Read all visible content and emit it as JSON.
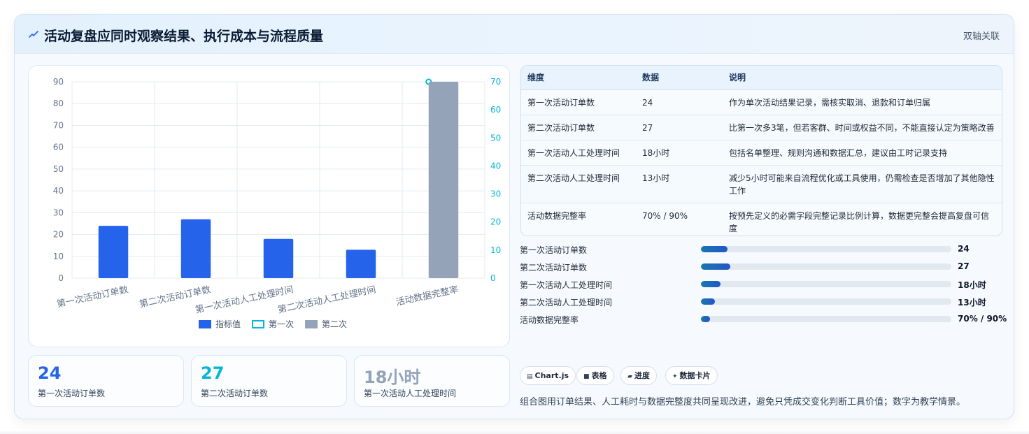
{
  "header": {
    "title": "活动复盘应同时观察结果、执行成本与流程质量",
    "tag": "双轴关联"
  },
  "colors": {
    "metric_bar": "#2563eb",
    "first_series": "#06b6d4",
    "second_series": "#94a3b8",
    "right_axis": "#06b6d4",
    "accent_text": "#2563eb"
  },
  "chart_data": {
    "type": "bar",
    "categories": [
      "第一次活动订单数",
      "第二次活动订单数",
      "第一次活动人工处理时间",
      "第二次活动人工处理时间",
      "活动数据完整率"
    ],
    "series": [
      {
        "name": "指标值",
        "type": "bar",
        "axis": "left",
        "values": [
          24,
          27,
          18,
          13,
          null
        ],
        "color": "#2563eb"
      },
      {
        "name": "第一次",
        "type": "line",
        "axis": "right",
        "values": [
          null,
          null,
          null,
          null,
          70
        ],
        "color": "#06b6d4"
      },
      {
        "name": "第二次",
        "type": "bar",
        "axis": "right",
        "values": [
          null,
          null,
          null,
          null,
          90
        ],
        "color": "#94a3b8"
      }
    ],
    "y_left": {
      "min": 0,
      "max": 90,
      "ticks": [
        "0",
        "10",
        "20",
        "30",
        "40",
        "50",
        "60",
        "70",
        "80",
        "90"
      ]
    },
    "y_right": {
      "min": 0,
      "max": 70,
      "ticks": [
        "0",
        "10",
        "20",
        "30",
        "40",
        "50",
        "60",
        "70"
      ]
    },
    "grid": true,
    "legend": "bottom"
  },
  "table": {
    "headers": [
      "维度",
      "数据",
      "说明"
    ],
    "rows": [
      [
        "第一次活动订单数",
        "24",
        "作为单次活动结果记录，需核实取消、退款和订单归属"
      ],
      [
        "第二次活动订单数",
        "27",
        "比第一次多3笔，但若客群、时间或权益不同，不能直接认定为策略改善"
      ],
      [
        "第一次活动人工处理时间",
        "18小时",
        "包括名单整理、规则沟通和数据汇总，建议由工时记录支持"
      ],
      [
        "第二次活动人工处理时间",
        "13小时",
        "减少5小时可能来自流程优化或工具使用，仍需检查是否增加了其他隐性工作"
      ],
      [
        "活动数据完整率",
        "70% / 90%",
        "按预先定义的必需字段完整记录比例计算，数据更完整会提高复盘可信度"
      ]
    ]
  },
  "progress": [
    {
      "label": "第一次活动订单数",
      "value": "24",
      "fraction": 0.105
    },
    {
      "label": "第二次活动订单数",
      "value": "27",
      "fraction": 0.118
    },
    {
      "label": "第一次活动人工处理时间",
      "value": "18小时",
      "fraction": 0.079
    },
    {
      "label": "第二次活动人工处理时间",
      "value": "13小时",
      "fraction": 0.057
    },
    {
      "label": "活动数据完整率",
      "value": "70% / 90%",
      "fraction": 0.035
    }
  ],
  "kpis": [
    {
      "value": "24",
      "label": "第一次活动订单数",
      "color": "#2563eb"
    },
    {
      "value": "27",
      "label": "第二次活动订单数",
      "color": "#06b6d4"
    },
    {
      "value": "18小时",
      "label": "第一次活动人工处理时间",
      "color": "#94a3b8"
    }
  ],
  "chips": [
    {
      "icon": "chart-icon",
      "glyph": "▤",
      "label": "Chart.js"
    },
    {
      "icon": "table-icon",
      "glyph": "■",
      "label": "表格"
    },
    {
      "icon": "progress-icon",
      "glyph": "▰",
      "label": "进度"
    },
    {
      "icon": "card-icon",
      "glyph": "✦",
      "label": "数据卡片"
    }
  ],
  "footer": {
    "note": "组合图用订单结果、人工耗时与数据完整度共同呈现改进，避免只凭成交变化判断工具价值；数字为教学情景。"
  }
}
